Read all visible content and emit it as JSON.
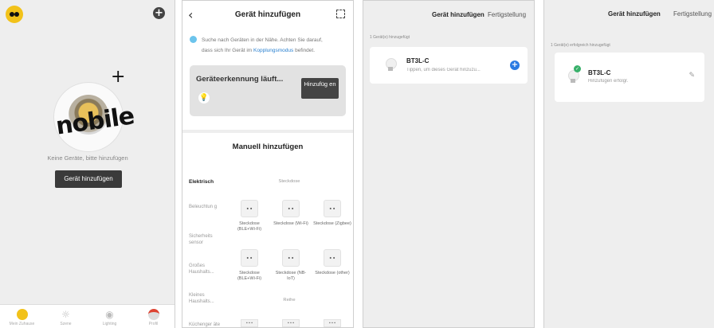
{
  "home": {
    "logo_text": "nobile",
    "empty_text": "Keine Geräte, bitte hinzufügen",
    "add_button": "Gerät hinzufügen",
    "nav": [
      {
        "label": "Mein Zuhause",
        "icon": "home-icon"
      },
      {
        "label": "Szene",
        "icon": "scene-icon"
      },
      {
        "label": "Lighting",
        "icon": "lighting-icon"
      },
      {
        "label": "Profil",
        "icon": "profile-icon"
      }
    ]
  },
  "add": {
    "title": "Gerät hinzufügen",
    "search_text_1": "Suche nach Geräten in der Nähe. Achten Sie darauf,",
    "search_text_2": "dass sich Ihr Gerät im",
    "search_link": "Kopplungsmodus",
    "search_text_3": "befindet.",
    "detect_title": "Geräteerkennung läuft...",
    "detect_button": "Hinzufüg en",
    "manual_title": "Manuell hinzufügen",
    "categories": [
      "Elektrisch",
      "Beleuchtun g",
      "Sicherheits sensor",
      "Großes Haushalts...",
      "Kleines Haushalts...",
      "Küchenger äte"
    ],
    "section_steckdose": "Steckdose",
    "section_reihe": "Reihe",
    "devices_row1": [
      "Steckdose (BLE+Wi-Fi)",
      "Steckdose (Wi-Fi)",
      "Steckdose (Zigbee)"
    ],
    "devices_row2": [
      "Steckdose (BLE+Wi-Fi)",
      "Steckdose (NB-IoT)",
      "Steckdose (other)"
    ]
  },
  "found": {
    "title": "Gerät hinzufügen",
    "done": "Fertigstellung",
    "count": "1 Gerät(e) hinzugefügt",
    "device_name": "BT3L-C",
    "device_sub": "Tippen, um dieses Gerät hinzuzu..."
  },
  "success": {
    "title": "Gerät hinzufügen",
    "done": "Fertigstellung",
    "count": "1 Gerät(e) erfolgreich hinzugefügt",
    "device_name": "BT3L-C",
    "device_sub": "Hinzufügen erfolgr."
  },
  "colors": {
    "accent": "#2a7ae2",
    "success": "#38b06a",
    "button_dark": "#3a3a3a"
  }
}
